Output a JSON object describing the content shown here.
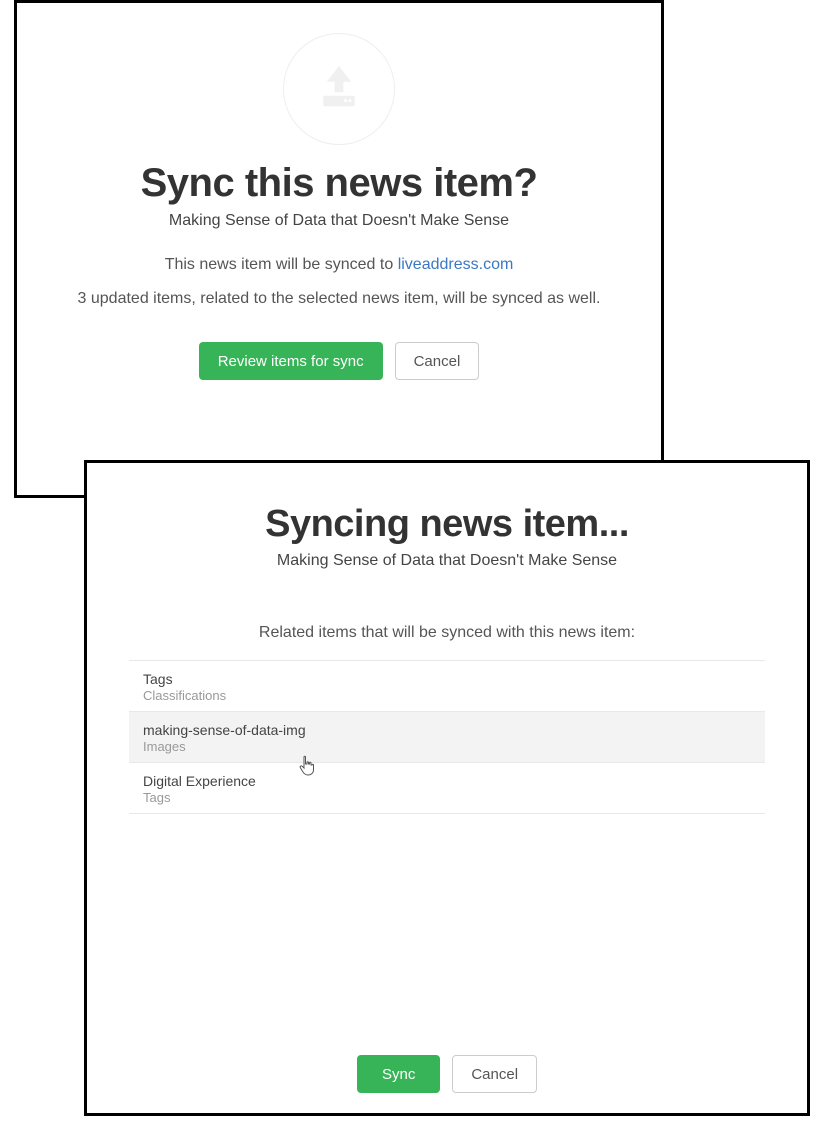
{
  "panel1": {
    "title": "Sync this news item?",
    "subtitle": "Making Sense of Data that Doesn't Make Sense",
    "sync_prefix": "This news item will be synced to ",
    "sync_link": "liveaddress.com",
    "extra_info": "3 updated items, related to the selected news item, will be synced as well.",
    "review_button": "Review items for sync",
    "cancel_button": "Cancel"
  },
  "panel2": {
    "title": "Syncing news item...",
    "subtitle": "Making Sense of Data that Doesn't Make Sense",
    "related_heading": "Related items that will be synced with this news item:",
    "items": [
      {
        "title": "Tags",
        "sub": "Classifications"
      },
      {
        "title": "making-sense-of-data-img",
        "sub": "Images"
      },
      {
        "title": "Digital Experience",
        "sub": "Tags"
      }
    ],
    "sync_button": "Sync",
    "cancel_button": "Cancel"
  }
}
